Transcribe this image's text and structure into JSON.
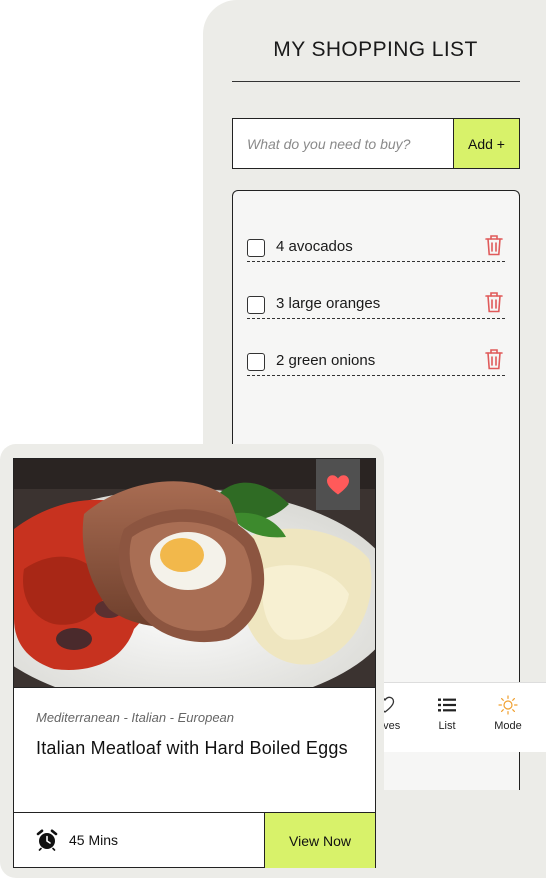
{
  "shopping_list": {
    "title": "MY SHOPPING LIST",
    "input_placeholder": "What do you need to buy?",
    "add_label": "Add +",
    "items": [
      {
        "label": "4 avocados",
        "checked": false
      },
      {
        "label": "3 large oranges",
        "checked": false
      },
      {
        "label": "2 green onions",
        "checked": false
      }
    ]
  },
  "bottom_nav": {
    "items": [
      {
        "label": "Saves",
        "icon": "heart-outline-icon"
      },
      {
        "label": "List",
        "icon": "list-icon"
      },
      {
        "label": "Mode",
        "icon": "sun-icon"
      }
    ]
  },
  "recipe_card": {
    "tags": "Mediterranean - Italian - European",
    "title": "Italian Meatloaf with Hard Boiled Eggs",
    "time": "45 Mins",
    "view_label": "View Now",
    "favorited": true
  },
  "colors": {
    "accent": "#d8f26a",
    "panel": "#ecece8",
    "trash": "#e05a5a",
    "heart": "#ff5a5a",
    "mode_icon": "#f0a030"
  }
}
